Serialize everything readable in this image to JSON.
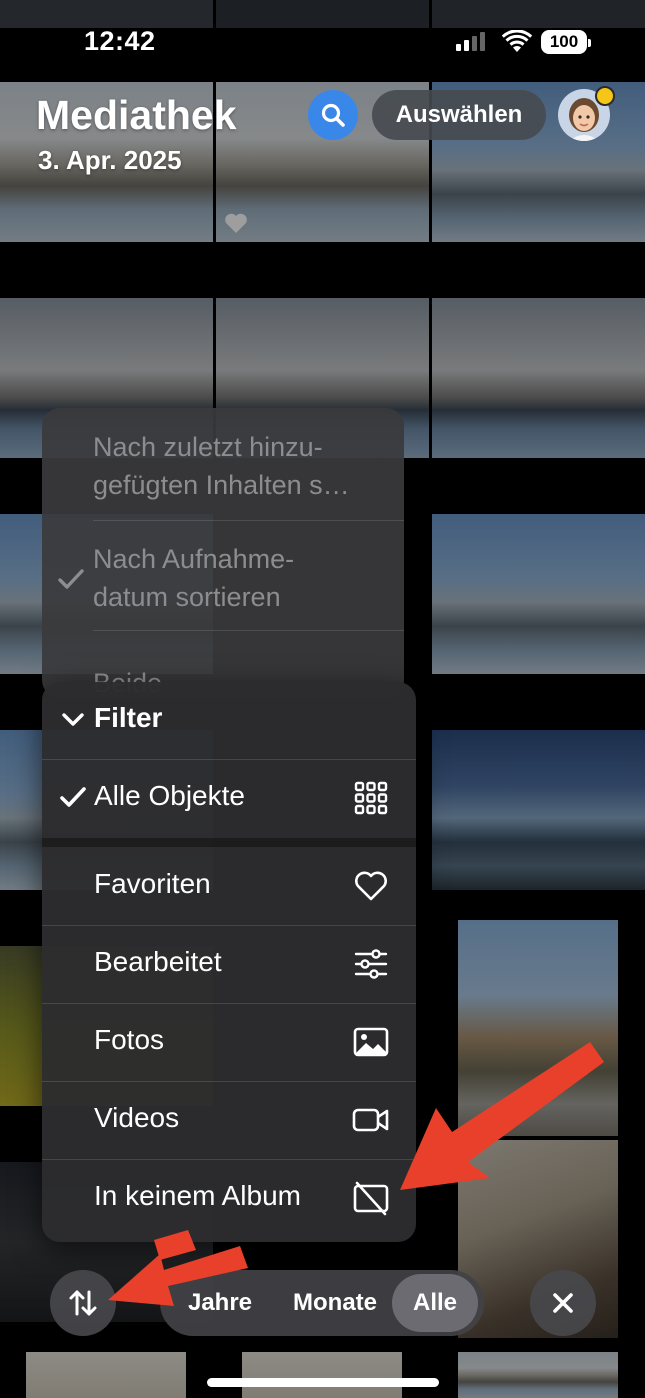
{
  "status_bar": {
    "time": "12:42",
    "battery": "100"
  },
  "header": {
    "title": "Mediathek",
    "date": "3. Apr. 2025",
    "select_label": "Auswählen"
  },
  "sort_menu": {
    "items": [
      {
        "label_line1": "Nach zuletzt hinzu-",
        "label_line2": "gefügten Inhalten s…",
        "checked": false
      },
      {
        "label_line1": "Nach Aufnahme-",
        "label_line2": "datum sortieren",
        "checked": true
      },
      {
        "label_line1": "Beide",
        "checked": false
      }
    ]
  },
  "filter_menu": {
    "header": "Filter",
    "items": [
      {
        "label": "Alle Objekte",
        "icon": "grid-icon",
        "checked": true
      },
      {
        "label": "Favoriten",
        "icon": "heart-icon",
        "checked": false
      },
      {
        "label": "Bearbeitet",
        "icon": "sliders-icon",
        "checked": false
      },
      {
        "label": "Fotos",
        "icon": "photo-icon",
        "checked": false
      },
      {
        "label": "Videos",
        "icon": "video-icon",
        "checked": false
      },
      {
        "label": "In keinem Album",
        "icon": "no-album-icon",
        "checked": false
      }
    ]
  },
  "view_switcher": {
    "years": "Jahre",
    "months": "Monate",
    "all": "Alle",
    "active": "Alle"
  },
  "colors": {
    "accent": "#3a87ea",
    "annotation_arrow": "#e8402a"
  }
}
